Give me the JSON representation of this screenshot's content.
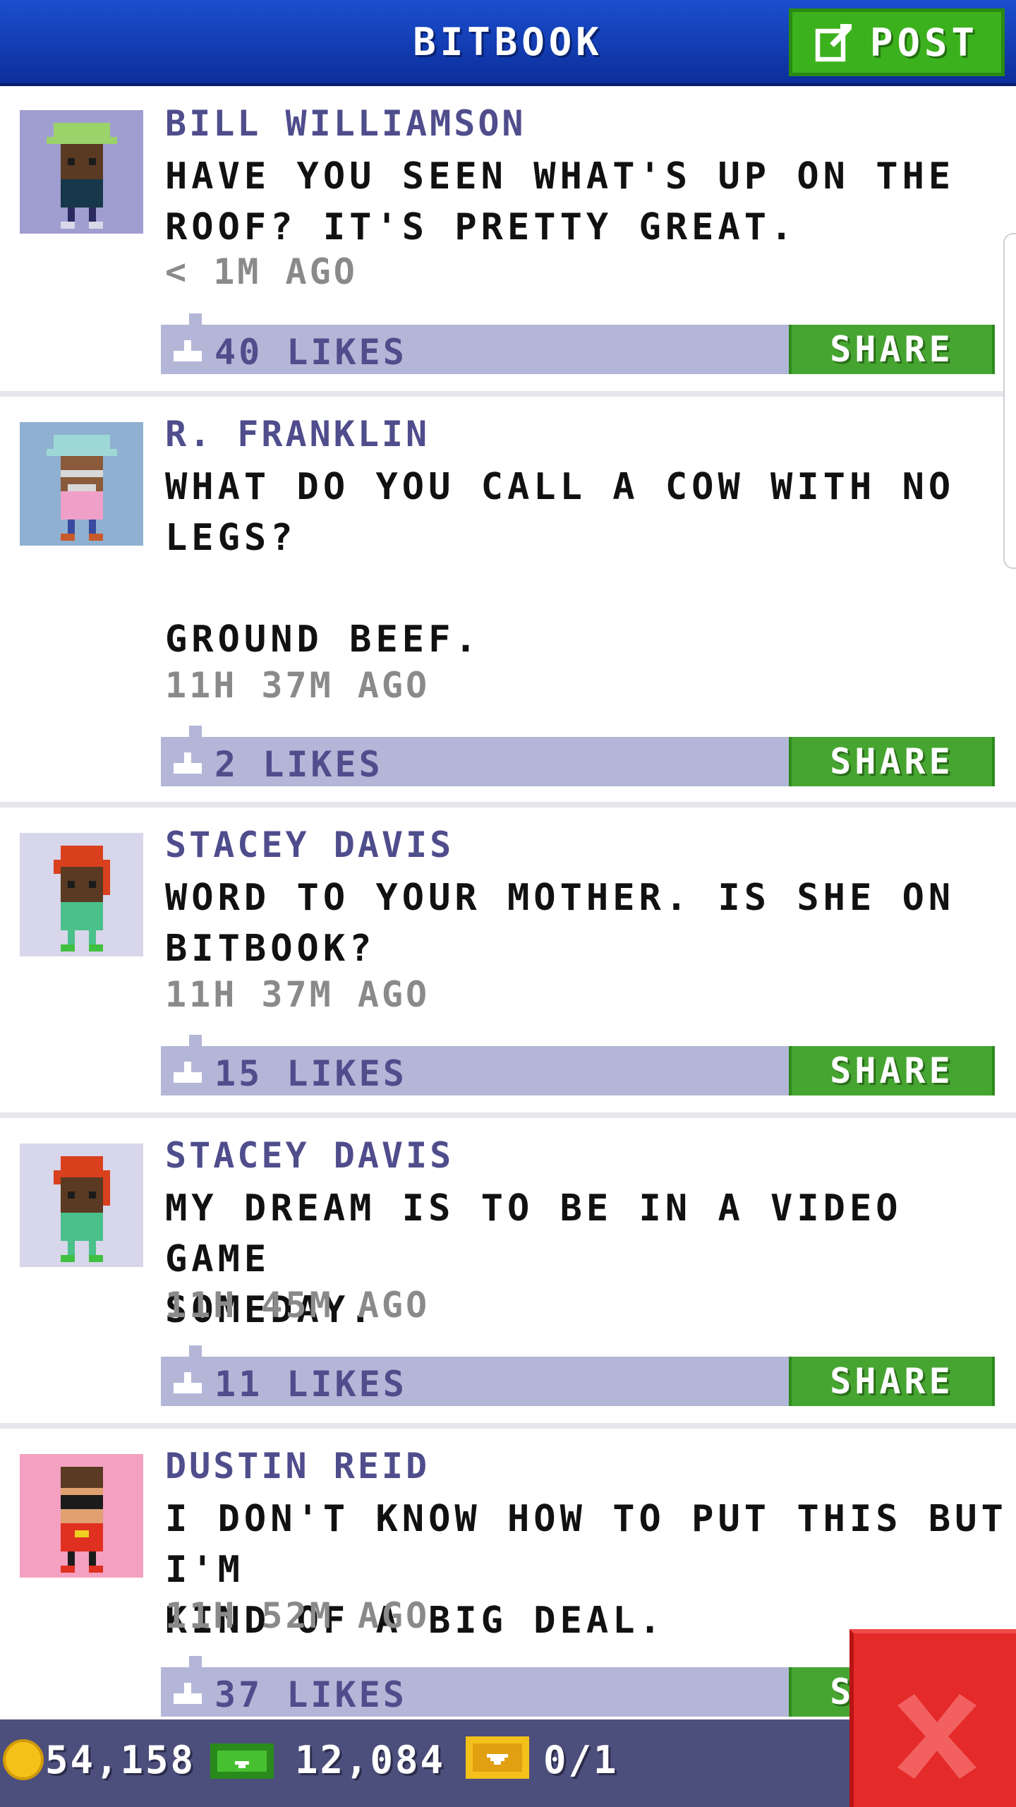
{
  "header": {
    "title": "BITBOOK",
    "post_label": "POST"
  },
  "colors": {
    "header_blue": "#1b4fcf",
    "post_green": "#3cb11e",
    "share_green": "#46a531",
    "likes_bar": "#b4b6d8",
    "author_purple": "#4f4d8c",
    "status_bar": "#4c4e7c",
    "close_red": "#e52a2a"
  },
  "posts": [
    {
      "author": "BILL WILLIAMSON",
      "message": "HAVE YOU SEEN WHAT'S UP ON THE\nROOF? IT'S PRETTY GREAT.",
      "time": "< 1M AGO",
      "likes": "40 LIKES",
      "share_label": "SHARE",
      "avatar_bg": "#a09ed0"
    },
    {
      "author": "R. FRANKLIN",
      "message": "WHAT DO YOU CALL A COW WITH NO\nLEGS?\n\nGROUND BEEF.",
      "time": "11H 37M AGO",
      "likes": "2 LIKES",
      "share_label": "SHARE",
      "avatar_bg": "#8fb0d0"
    },
    {
      "author": "STACEY DAVIS",
      "message": "WORD TO YOUR MOTHER. IS SHE ON\nBITBOOK?",
      "time": "11H 37M AGO",
      "likes": "15 LIKES",
      "share_label": "SHARE",
      "avatar_bg": "#d8d6ea"
    },
    {
      "author": "STACEY DAVIS",
      "message": "MY DREAM IS TO BE IN A VIDEO GAME\nSOMEDAY.",
      "time": "11H 45M AGO",
      "likes": "11 LIKES",
      "share_label": "SHARE",
      "avatar_bg": "#d8d6ea"
    },
    {
      "author": "DUSTIN REID",
      "message": "I DON'T KNOW HOW TO PUT THIS BUT I'M\nKIND OF A BIG DEAL.",
      "time": "11H 52M AGO",
      "likes": "37 LIKES",
      "share_label": "SHARE",
      "avatar_bg": "#f4a0c0"
    }
  ],
  "status": {
    "coins": "54,158",
    "bux": "12,084",
    "tickets": "0/1"
  },
  "icons": {
    "post": "edit-icon",
    "like": "thumbs-up-icon",
    "coin": "coin-icon",
    "bux": "cash-icon",
    "ticket": "ticket-icon",
    "close": "close-icon"
  }
}
